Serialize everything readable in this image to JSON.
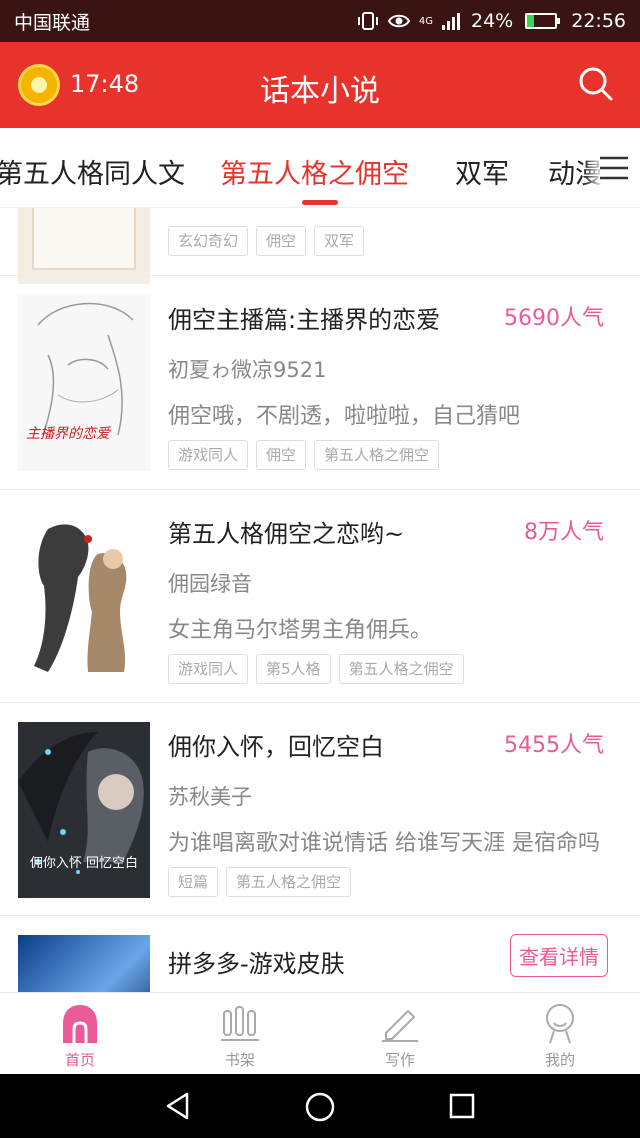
{
  "status_bar": {
    "carrier": "中国联通",
    "network": "4G",
    "battery": "24%",
    "battery_level": 0.24,
    "time": "22:56"
  },
  "header": {
    "time": "17:48",
    "title": "话本小说"
  },
  "tabs": [
    {
      "label": "第五人格同人文"
    },
    {
      "label": "第五人格之佣空"
    },
    {
      "label": "双军"
    },
    {
      "label": "动漫"
    }
  ],
  "items": [
    {
      "tags": [
        "玄幻奇幻",
        "佣空",
        "双军"
      ]
    },
    {
      "title": "佣空主播篇:主播界的恋爱",
      "popularity": "5690人气",
      "author": "初夏ゎ微凉9521",
      "description": "佣空哦，不剧透，啦啦啦，自己猜吧",
      "tags": [
        "游戏同人",
        "佣空",
        "第五人格之佣空"
      ],
      "cover_text": "主播界的恋爱"
    },
    {
      "title": "第五人格佣空之恋哟~",
      "popularity": "8万人气",
      "author": "佣园绿音",
      "description": "女主角马尔塔男主角佣兵。",
      "tags": [
        "游戏同人",
        "第5人格",
        "第五人格之佣空"
      ]
    },
    {
      "title": "佣你入怀，回忆空白",
      "popularity": "5455人气",
      "author": "苏秋美子",
      "description": "为谁唱离歌对谁说情话 给谁写天涯 是宿命吗",
      "tags": [
        "短篇",
        "第五人格之佣空"
      ],
      "cover_text": "佣你入怀 回忆空白"
    },
    {
      "title": "拼多多-游戏皮肤",
      "button": "查看详情"
    }
  ],
  "bottom_nav": [
    {
      "label": "首页",
      "icon": "home-icon"
    },
    {
      "label": "书架",
      "icon": "bookshelf-icon"
    },
    {
      "label": "写作",
      "icon": "pen-icon"
    },
    {
      "label": "我的",
      "icon": "user-icon"
    }
  ],
  "colors": {
    "primary": "#e8332d",
    "accent": "#e95a97",
    "status_bar": "#3a1313"
  }
}
